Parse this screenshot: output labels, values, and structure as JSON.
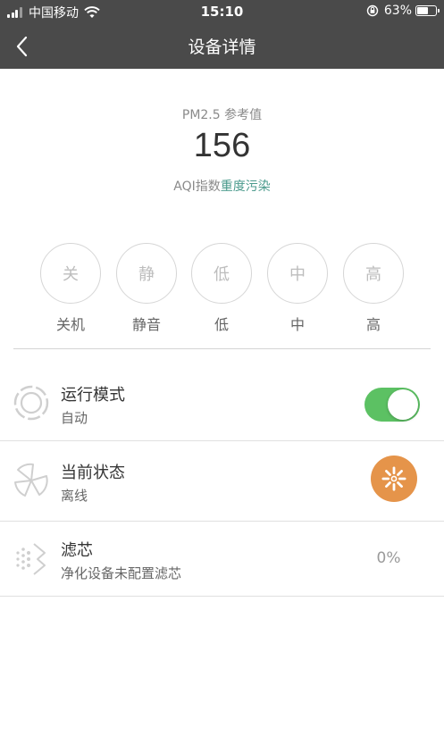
{
  "status_bar": {
    "carrier": "中国移动",
    "time": "15:10",
    "battery_text": "63%",
    "battery_level": 0.63
  },
  "nav": {
    "title": "设备详情"
  },
  "air": {
    "pm_label": "PM2.5 参考值",
    "pm_value": "156",
    "aqi_prefix": "AQI指数",
    "aqi_level": "重度污染",
    "aqi_level_color": "#4a9a8c"
  },
  "speeds": [
    {
      "short": "关",
      "label": "关机"
    },
    {
      "short": "静",
      "label": "静音"
    },
    {
      "short": "低",
      "label": "低"
    },
    {
      "short": "中",
      "label": "中"
    },
    {
      "short": "高",
      "label": "高"
    }
  ],
  "rows": {
    "mode": {
      "title": "运行模式",
      "sub": "自动",
      "toggle_on": true
    },
    "state": {
      "title": "当前状态",
      "sub": "离线"
    },
    "filter": {
      "title": "滤芯",
      "sub": "净化设备未配置滤芯",
      "value": "0%"
    }
  },
  "colors": {
    "header_bg": "#4a4a4a",
    "toggle_on": "#5cc163",
    "fan_button": "#e5944a"
  },
  "icons": {
    "back": "chevron-left-icon",
    "mode": "ring-icon",
    "state": "fan-blades-icon",
    "filter": "filter-dots-icon",
    "fan": "fan-icon"
  }
}
